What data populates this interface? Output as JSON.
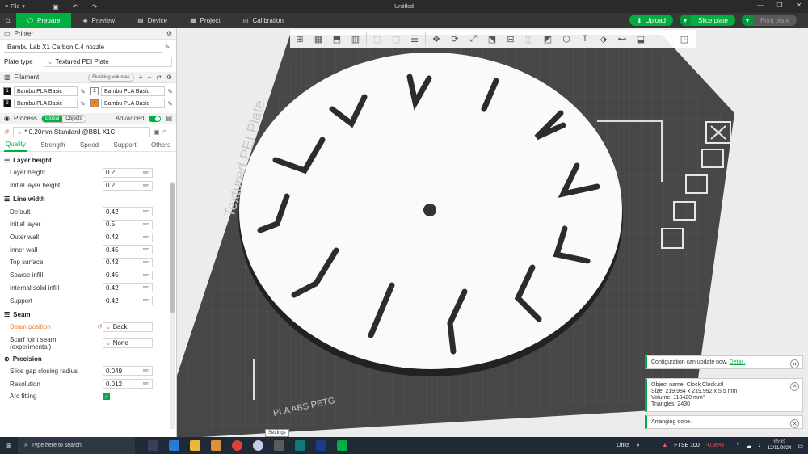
{
  "titlebar": {
    "menu_label": "File",
    "window_title": "Untitled"
  },
  "toolbar": {
    "tabs": [
      {
        "label": "Prepare",
        "icon": "cube-icon",
        "active": true
      },
      {
        "label": "Preview",
        "icon": "layers-icon",
        "active": false
      },
      {
        "label": "Device",
        "icon": "device-icon",
        "active": false
      },
      {
        "label": "Project",
        "icon": "project-icon",
        "active": false
      },
      {
        "label": "Calibration",
        "icon": "calibration-icon",
        "active": false
      }
    ],
    "upload_label": "Upload",
    "slice_label": "Slice plate",
    "print_label": "Print plate",
    "accent_color": "#00ae42"
  },
  "printer": {
    "section_label": "Printer",
    "printer_name": "Bambu Lab X1 Carbon 0.4 nozzle",
    "plate_type_label": "Plate type",
    "plate_type_value": "Textured PEI Plate"
  },
  "filament": {
    "section_label": "Filament",
    "flushing_label": "Flushing volumes",
    "slots": [
      {
        "num": "1",
        "name": "Bambu PLA Basic",
        "color": "#111111"
      },
      {
        "num": "2",
        "name": "Bambu PLA Basic",
        "color": "#ffffff"
      },
      {
        "num": "3",
        "name": "Bambu PLA Basic",
        "color": "#111111"
      },
      {
        "num": "4",
        "name": "Bambu PLA Basic",
        "color": "#f5841f"
      }
    ]
  },
  "process": {
    "section_label": "Process",
    "global_label": "Global",
    "objects_label": "Objects",
    "advanced_label": "Advanced",
    "preset": "* 0.20mm Standard @BBL X1C",
    "subtabs": [
      "Quality",
      "Strength",
      "Speed",
      "Support",
      "Others"
    ],
    "groups": {
      "layer_height": {
        "title": "Layer height",
        "rows": [
          {
            "label": "Layer height",
            "value": "0.2",
            "unit": "mm"
          },
          {
            "label": "Initial layer height",
            "value": "0.2",
            "unit": "mm"
          }
        ]
      },
      "line_width": {
        "title": "Line width",
        "rows": [
          {
            "label": "Default",
            "value": "0.42",
            "unit": "mm"
          },
          {
            "label": "Initial layer",
            "value": "0.5",
            "unit": "mm"
          },
          {
            "label": "Outer wall",
            "value": "0.42",
            "unit": "mm"
          },
          {
            "label": "Inner wall",
            "value": "0.45",
            "unit": "mm"
          },
          {
            "label": "Top surface",
            "value": "0.42",
            "unit": "mm"
          },
          {
            "label": "Sparse infill",
            "value": "0.45",
            "unit": "mm"
          },
          {
            "label": "Internal solid infill",
            "value": "0.42",
            "unit": "mm"
          },
          {
            "label": "Support",
            "value": "0.42",
            "unit": "mm"
          }
        ]
      },
      "seam": {
        "title": "Seam",
        "seam_position_label": "Seam position",
        "seam_position_value": "Back",
        "scarf_label_1": "Scarf joint seam",
        "scarf_label_2": "(experimental)",
        "scarf_value": "None"
      },
      "precision": {
        "title": "Precision",
        "rows": [
          {
            "label": "Slice gap closing radius",
            "value": "0.049",
            "unit": "mm"
          },
          {
            "label": "Resolution",
            "value": "0.012",
            "unit": "mm"
          }
        ],
        "arc_fitting_label": "Arc fitting"
      }
    }
  },
  "viewport": {
    "plate_text_top": "Textured PEI Plate",
    "plate_text_bottom": "PLA ABS PETG",
    "notifications": [
      {
        "text": "Configuration can update now.",
        "link": "Detail."
      },
      {
        "line1": "Object name: Clock Clock.stl",
        "line2": "Size: 219.984 x 219.992 x 5.5 mm",
        "line3": "Volume: 118420 mm³",
        "line4": "Triangles: 2430"
      },
      {
        "text": "Arranging done."
      }
    ],
    "tooltip": "Settings"
  },
  "taskbar": {
    "search_placeholder": "Type here to search",
    "links_label": "Links",
    "ticker_name": "FTSE 100",
    "ticker_change": "-0.95%",
    "time": "10:32",
    "date": "12/11/2024"
  }
}
